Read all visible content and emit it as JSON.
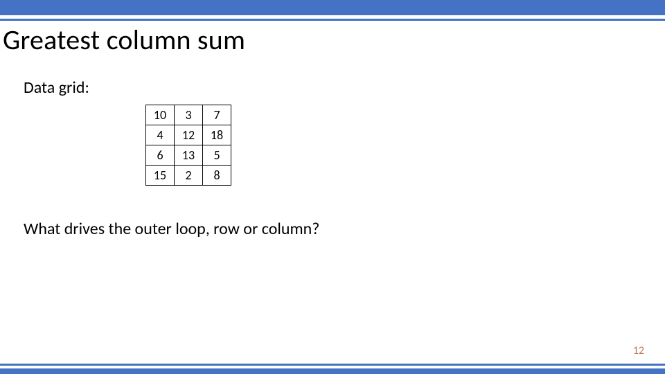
{
  "title": "Greatest column sum",
  "subtitle": "Data grid:",
  "question": "What drives the outer loop, row or column?",
  "page_number": "12",
  "chart_data": {
    "type": "table",
    "rows": [
      [
        "10",
        "3",
        "7"
      ],
      [
        "4",
        "12",
        "18"
      ],
      [
        "6",
        "13",
        "5"
      ],
      [
        "15",
        "2",
        "8"
      ]
    ]
  }
}
